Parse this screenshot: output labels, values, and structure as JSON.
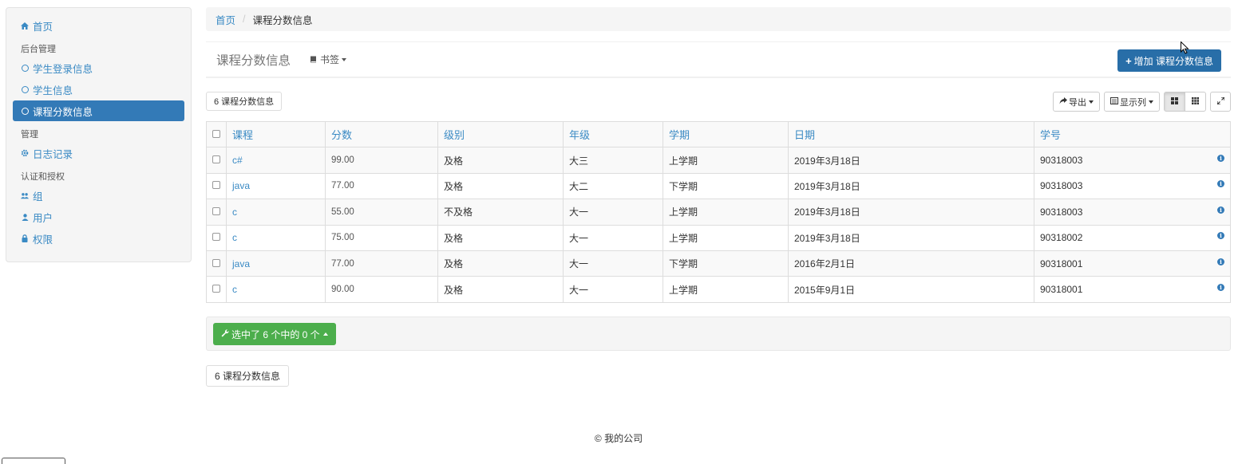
{
  "sidebar": {
    "home": {
      "label": "首页",
      "icon": "home-icon"
    },
    "section_admin": "后台管理",
    "admin_items": [
      {
        "label": "学生登录信息",
        "icon": "circle-icon"
      },
      {
        "label": "学生信息",
        "icon": "circle-icon"
      },
      {
        "label": "课程分数信息",
        "icon": "circle-icon",
        "active": true
      }
    ],
    "section_manage": "管理",
    "log": {
      "label": "日志记录",
      "icon": "gear-icon"
    },
    "section_auth": "认证和授权",
    "auth_items": [
      {
        "label": "组",
        "icon": "users-icon"
      },
      {
        "label": "用户",
        "icon": "user-icon"
      },
      {
        "label": "权限",
        "icon": "lock-icon"
      }
    ]
  },
  "breadcrumb": {
    "home": "首页",
    "current": "课程分数信息"
  },
  "header": {
    "title": "课程分数信息",
    "bookmark": "书签",
    "add_button": "增加 课程分数信息"
  },
  "toolbar": {
    "count": "6 课程分数信息",
    "export": "导出",
    "columns": "显示列"
  },
  "table": {
    "headers": [
      "课程",
      "分数",
      "级别",
      "年级",
      "学期",
      "日期",
      "学号"
    ],
    "rows": [
      [
        "c#",
        "99.00",
        "及格",
        "大三",
        "上学期",
        "2019年3月18日",
        "90318003"
      ],
      [
        "java",
        "77.00",
        "及格",
        "大二",
        "下学期",
        "2019年3月18日",
        "90318003"
      ],
      [
        "c",
        "55.00",
        "不及格",
        "大一",
        "上学期",
        "2019年3月18日",
        "90318003"
      ],
      [
        "c",
        "75.00",
        "及格",
        "大一",
        "上学期",
        "2019年3月18日",
        "90318002"
      ],
      [
        "java",
        "77.00",
        "及格",
        "大一",
        "下学期",
        "2016年2月1日",
        "90318001"
      ],
      [
        "c",
        "90.00",
        "及格",
        "大一",
        "上学期",
        "2015年9月1日",
        "90318001"
      ]
    ]
  },
  "batch": {
    "label": "选中了 6 个中的 0 个"
  },
  "footer_count": "6 课程分数信息",
  "footer": "© 我的公司",
  "colors": {
    "primary": "#337ab7",
    "success": "#4cae4c",
    "link": "#3a8ac4"
  }
}
